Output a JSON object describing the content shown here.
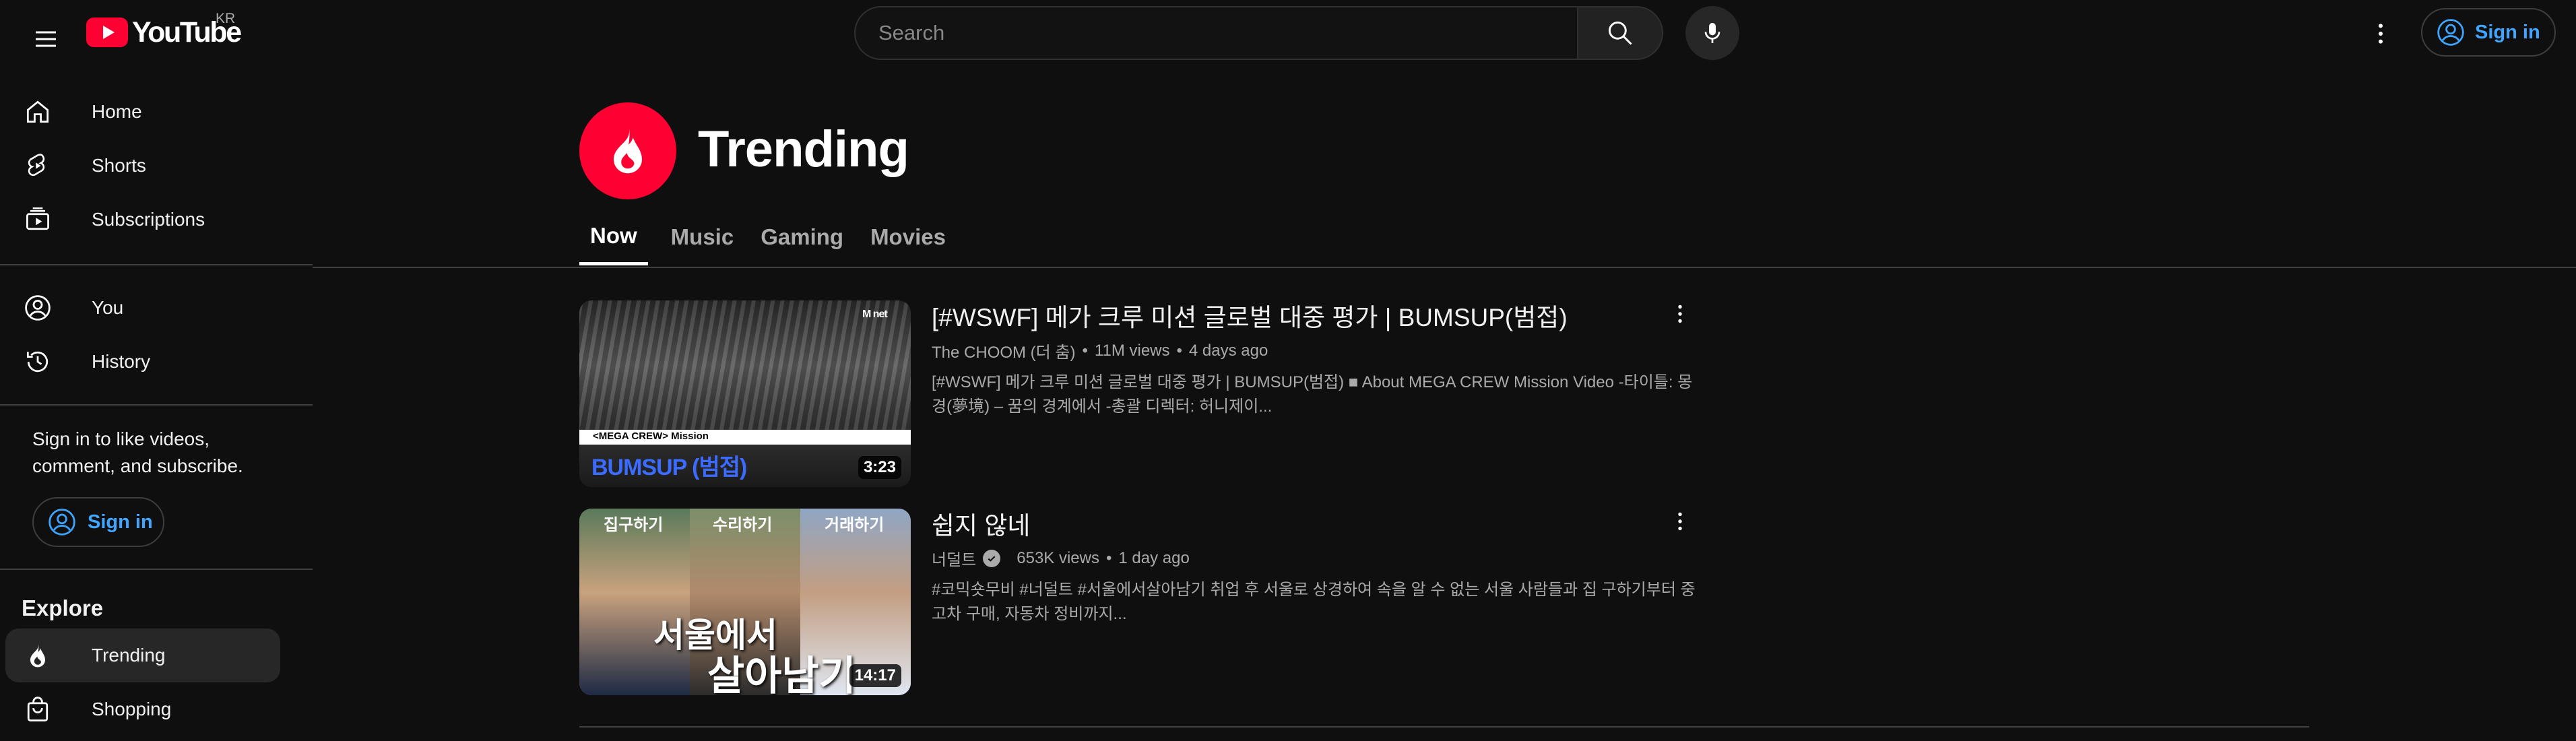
{
  "masthead": {
    "logo_text": "YouTube",
    "region_code": "KR",
    "search_placeholder": "Search",
    "sign_in_label": "Sign in"
  },
  "sidebar": {
    "primary": [
      {
        "label": "Home",
        "icon": "home-icon"
      },
      {
        "label": "Shorts",
        "icon": "shorts-icon"
      },
      {
        "label": "Subscriptions",
        "icon": "subscriptions-icon"
      }
    ],
    "secondary": [
      {
        "label": "You",
        "icon": "you-icon"
      },
      {
        "label": "History",
        "icon": "history-icon"
      }
    ],
    "signin_prompt": "Sign in to like videos, comment, and subscribe.",
    "signin_button": "Sign in",
    "explore_heading": "Explore",
    "explore": [
      {
        "label": "Trending",
        "icon": "trending-icon",
        "active": true
      },
      {
        "label": "Shopping",
        "icon": "shopping-icon"
      }
    ]
  },
  "page": {
    "title": "Trending",
    "tabs": [
      {
        "label": "Now",
        "active": true
      },
      {
        "label": "Music"
      },
      {
        "label": "Gaming"
      },
      {
        "label": "Movies"
      }
    ]
  },
  "videos": [
    {
      "title": "[#WSWF] 메가 크루 미션 글로벌 대중 평가 | BUMSUP(범접)",
      "channel": "The CHOOM (더 춤)",
      "verified": false,
      "views": "11M views",
      "age": "4 days ago",
      "description": "[#WSWF] 메가 크루 미션 글로벌 대중 평가 | BUMSUP(범접) ■ About MEGA CREW Mission Video -타이틀: 몽경(夢境) – 꿈의 경계에서 -총괄 디렉터: 허니제이...",
      "duration": "3:23",
      "thumb_caption": "<MEGA CREW> Mission",
      "thumb_name": "BUMSUP (범접)",
      "thumb_badge": "M net"
    },
    {
      "title": "쉽지 않네",
      "channel": "너덜트",
      "verified": true,
      "views": "653K views",
      "age": "1 day ago",
      "description": "#코믹숏무비 #너덜트 #서울에서살아남기 취업 후 서울로 상경하여 속을 알 수 없는 서울 사람들과 집 구하기부터 중고차 구매, 자동차 정비까지...",
      "duration": "14:17",
      "thumb_labels": [
        "집구하기",
        "수리하기",
        "거래하기"
      ],
      "thumb_title_line1": "서울에서",
      "thumb_title_line2": "살아남기"
    }
  ],
  "colors": {
    "background": "#0f0f0f",
    "brand_red": "#ff0033",
    "link_blue": "#3ea6ff",
    "muted_text": "#aaaaaa"
  }
}
